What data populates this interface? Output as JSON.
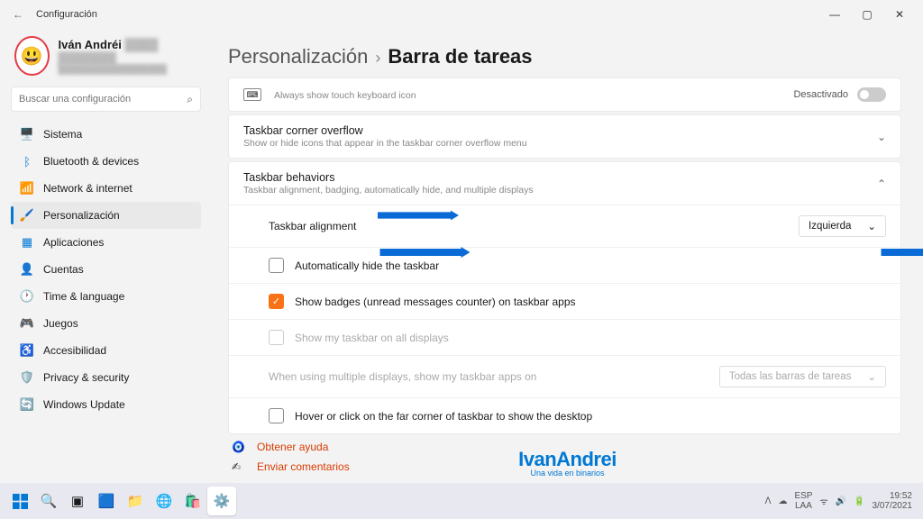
{
  "titlebar": {
    "back": "←",
    "title": "Configuración"
  },
  "user": {
    "name": "Iván Andréi",
    "name_blur": "████ ███████",
    "email": "█████████████████"
  },
  "search": {
    "placeholder": "Buscar una configuración",
    "icon": "⌕"
  },
  "nav": [
    {
      "icon": "🖥️",
      "label": "Sistema",
      "color": "#0078d4"
    },
    {
      "icon": "ᛒ",
      "label": "Bluetooth & devices",
      "color": "#0078d4"
    },
    {
      "icon": "📶",
      "label": "Network & internet",
      "color": "#0078d4"
    },
    {
      "icon": "🖌️",
      "label": "Personalización",
      "color": "#d83b01",
      "active": true
    },
    {
      "icon": "▦",
      "label": "Aplicaciones",
      "color": "#0078d4"
    },
    {
      "icon": "👤",
      "label": "Cuentas",
      "color": "#0078d4"
    },
    {
      "icon": "🕐",
      "label": "Time & language",
      "color": "#0078d4"
    },
    {
      "icon": "🎮",
      "label": "Juegos",
      "color": "#607d8b"
    },
    {
      "icon": "♿",
      "label": "Accesibilidad",
      "color": "#0078d4"
    },
    {
      "icon": "🛡️",
      "label": "Privacy & security",
      "color": "#607d8b"
    },
    {
      "icon": "🔄",
      "label": "Windows Update",
      "color": "#0078d4"
    }
  ],
  "breadcrumb": {
    "parent": "Personalización",
    "sep": "›",
    "current": "Barra de tareas"
  },
  "touchkb": {
    "icon": "⌨",
    "sub": "Always show touch keyboard icon",
    "state": "Desactivado"
  },
  "overflow": {
    "title": "Taskbar corner overflow",
    "sub": "Show or hide icons that appear in the taskbar corner overflow menu"
  },
  "behaviors": {
    "title": "Taskbar behaviors",
    "sub": "Taskbar alignment, badging, automatically hide, and multiple displays"
  },
  "opts": {
    "align_label": "Taskbar alignment",
    "align_value": "Izquierda",
    "autohide": "Automatically hide the taskbar",
    "badges": "Show badges (unread messages counter) on taskbar apps",
    "alldisplays": "Show my taskbar on all displays",
    "multidisp": "When using multiple displays, show my taskbar apps on",
    "multidisp_value": "Todas las barras de tareas",
    "hovercorner": "Hover or click on the far corner of taskbar to show the desktop"
  },
  "help": {
    "get": "Obtener ayuda",
    "feedback": "Enviar comentarios"
  },
  "watermark": {
    "line1": "IvanAndrei",
    "line2": "Una vida en binarios"
  },
  "tray": {
    "lang1": "ESP",
    "lang2": "LAA",
    "time": "19:52",
    "date": "3/07/2021"
  }
}
